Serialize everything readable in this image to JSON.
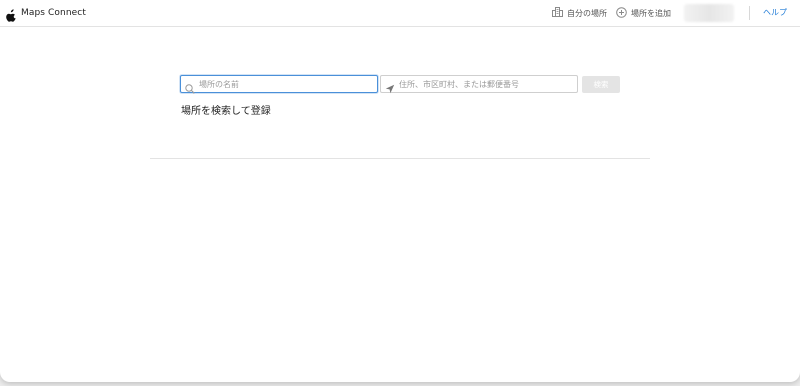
{
  "header": {
    "brand": "Maps Connect",
    "nav": [
      {
        "label": "自分の場所",
        "icon": "building-icon"
      },
      {
        "label": "場所を追加",
        "icon": "plus-circle-icon"
      }
    ],
    "help": "ヘルプ"
  },
  "search": {
    "name_placeholder": "場所の名前",
    "name_value": "",
    "address_placeholder": "住所、市区町村、または郵便番号",
    "address_value": "",
    "button_label": "検索"
  },
  "main": {
    "heading": "場所を検索して登録"
  },
  "colors": {
    "link": "#1e7ad6",
    "focus_border": "#4a90d9",
    "disabled_button": "#e4e4e4"
  }
}
